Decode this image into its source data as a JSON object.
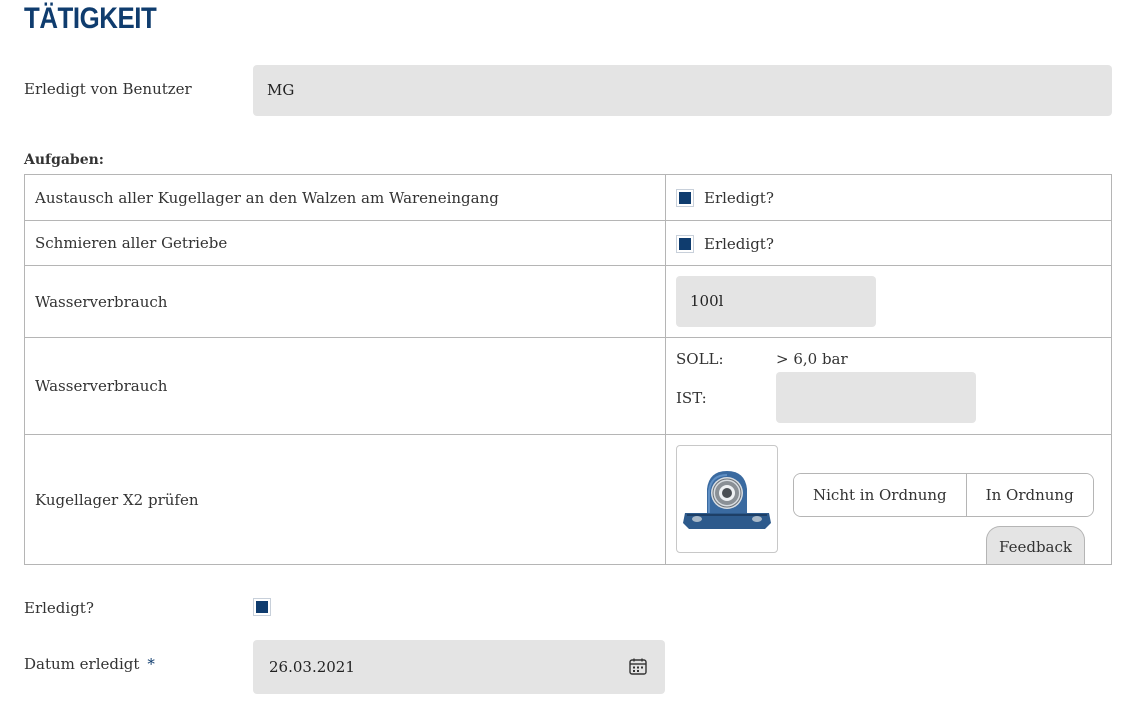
{
  "header": {
    "title": "TÄTIGKEIT"
  },
  "user": {
    "label": "Erledigt von Benutzer",
    "value": "MG"
  },
  "tasks": {
    "heading": "Aufgaben:",
    "rows": [
      {
        "label": "Austausch aller Kugellager an den Walzen am Wareneingang",
        "checkbox_label": "Erledigt?"
      },
      {
        "label": "Schmieren aller Getriebe",
        "checkbox_label": "Erledigt?"
      },
      {
        "label": "Wasserverbrauch",
        "value": "100l"
      },
      {
        "label": "Wasserverbrauch",
        "soll_label": "SOLL:",
        "soll_value": "> 6,0 bar",
        "ist_label": "IST:",
        "ist_value": ""
      },
      {
        "label": "Kugellager X2 prüfen",
        "btn_not_ok": "Nicht in Ordnung",
        "btn_ok": "In Ordnung",
        "feedback": "Feedback"
      }
    ]
  },
  "done": {
    "label": "Erledigt?"
  },
  "date": {
    "label": "Datum erledigt",
    "required_mark": "*",
    "value": "26.03.2021"
  },
  "colors": {
    "accent": "#0f3c6e",
    "field_bg": "#e4e4e4",
    "border": "#b5b5b5"
  },
  "icons": {
    "calendar": "calendar-icon",
    "bearing": "bearing-image"
  }
}
